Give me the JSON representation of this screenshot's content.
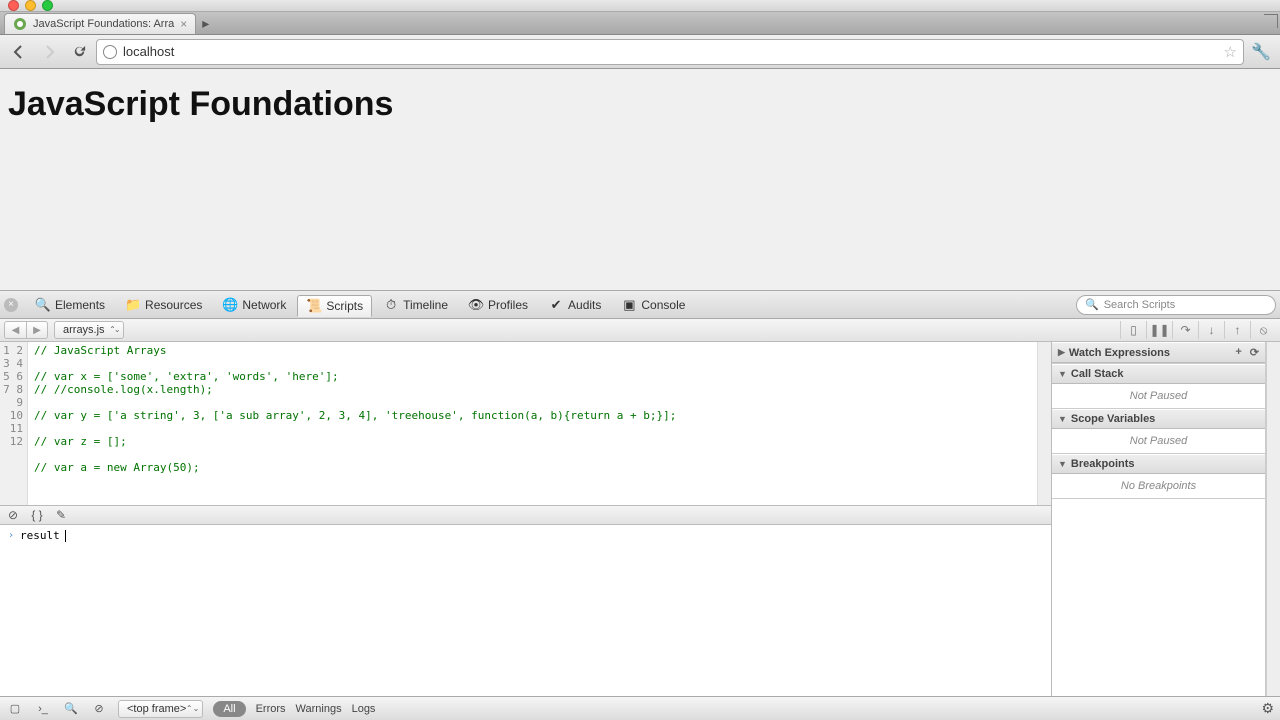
{
  "window": {
    "tab_title": "JavaScript Foundations: Arra",
    "url": "localhost"
  },
  "page": {
    "heading": "JavaScript Foundations"
  },
  "devtools": {
    "tabs": {
      "elements": "Elements",
      "resources": "Resources",
      "network": "Network",
      "scripts": "Scripts",
      "timeline": "Timeline",
      "profiles": "Profiles",
      "audits": "Audits",
      "console": "Console"
    },
    "search_placeholder": "Search Scripts",
    "file": "arrays.js",
    "code_lines": [
      "// JavaScript Arrays",
      "",
      "// var x = ['some', 'extra', 'words', 'here'];",
      "// //console.log(x.length);",
      "",
      "// var y = ['a string', 3, ['a sub array', 2, 3, 4], 'treehouse', function(a, b){return a + b;}];",
      "",
      "// var z = [];",
      "",
      "// var a = new Array(50);",
      "",
      ""
    ],
    "console_input": "result",
    "sidebar": {
      "watch": {
        "title": "Watch Expressions"
      },
      "callstack": {
        "title": "Call Stack",
        "body": "Not Paused"
      },
      "scope": {
        "title": "Scope Variables",
        "body": "Not Paused"
      },
      "breakpoints": {
        "title": "Breakpoints",
        "body": "No Breakpoints"
      }
    },
    "status": {
      "frame": "<top frame>",
      "all": "All",
      "errors": "Errors",
      "warnings": "Warnings",
      "logs": "Logs"
    }
  }
}
